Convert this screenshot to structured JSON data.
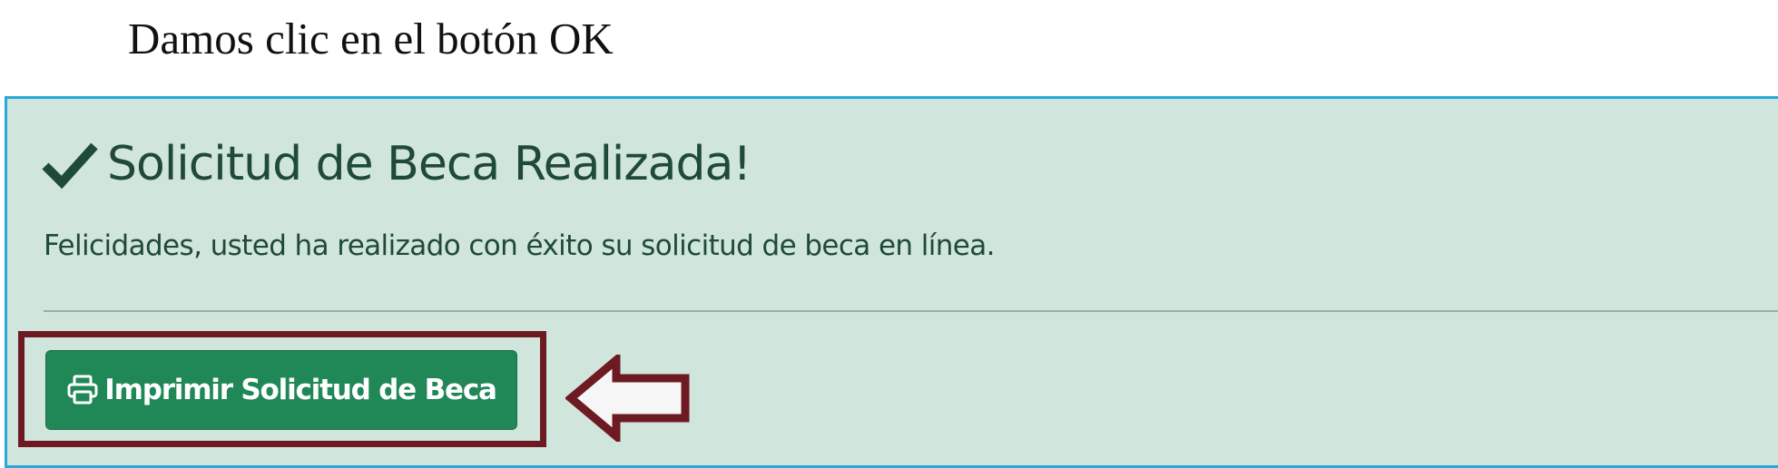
{
  "instruction": {
    "text": "Damos clic en el botón OK"
  },
  "alert": {
    "icon": "check-icon",
    "heading": "Solicitud de Beca Realizada!",
    "message": "Felicidades, usted ha realizado con éxito su solicitud de beca en línea.",
    "background_color": "#d0e5dc",
    "text_color": "#1f4a3a"
  },
  "print_button": {
    "icon": "printer-icon",
    "label": "Imprimir Solicitud de Beca",
    "color": "#208757"
  },
  "annotation": {
    "highlight_color": "#6e1a22",
    "arrow_icon": "left-arrow-icon",
    "frame_color": "#2aa8d8"
  }
}
